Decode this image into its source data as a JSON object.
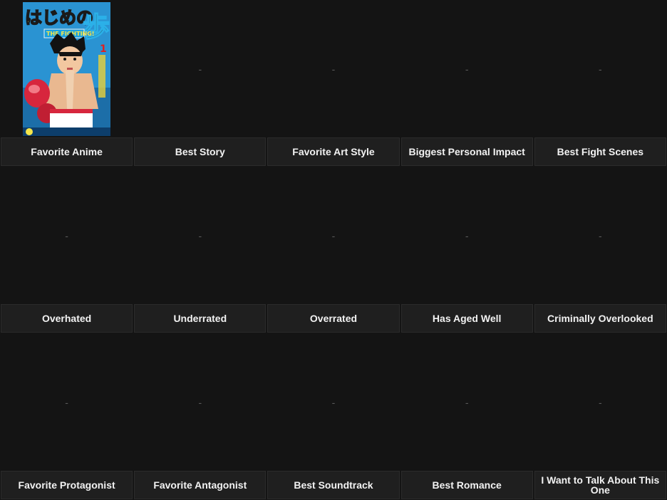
{
  "cells": [
    {
      "label": "Favorite Anime",
      "placeholder": "",
      "cover": {
        "title_text": "はじめの歩",
        "subtitle_text": "THE FIGHTING!",
        "volume": "1"
      }
    },
    {
      "label": "Best Story",
      "placeholder": "-"
    },
    {
      "label": "Favorite Art Style",
      "placeholder": "-"
    },
    {
      "label": "Biggest Personal Impact",
      "placeholder": "-"
    },
    {
      "label": "Best Fight Scenes",
      "placeholder": "-"
    },
    {
      "label": "Overhated",
      "placeholder": "-"
    },
    {
      "label": "Underrated",
      "placeholder": "-"
    },
    {
      "label": "Overrated",
      "placeholder": "-"
    },
    {
      "label": "Has Aged Well",
      "placeholder": "-"
    },
    {
      "label": "Criminally Overlooked",
      "placeholder": "-"
    },
    {
      "label": "Favorite Protagonist",
      "placeholder": "-"
    },
    {
      "label": "Favorite Antagonist",
      "placeholder": "-"
    },
    {
      "label": "Best Soundtrack",
      "placeholder": "-"
    },
    {
      "label": "Best Romance",
      "placeholder": "-"
    },
    {
      "label": "I Want to Talk About This One",
      "placeholder": "-"
    }
  ],
  "colors": {
    "background": "#141414",
    "label_bg": "#1f1f1f",
    "label_text": "#f2f2f2",
    "placeholder": "#5a5a5a",
    "cover_blue": "#2c9ad8"
  }
}
